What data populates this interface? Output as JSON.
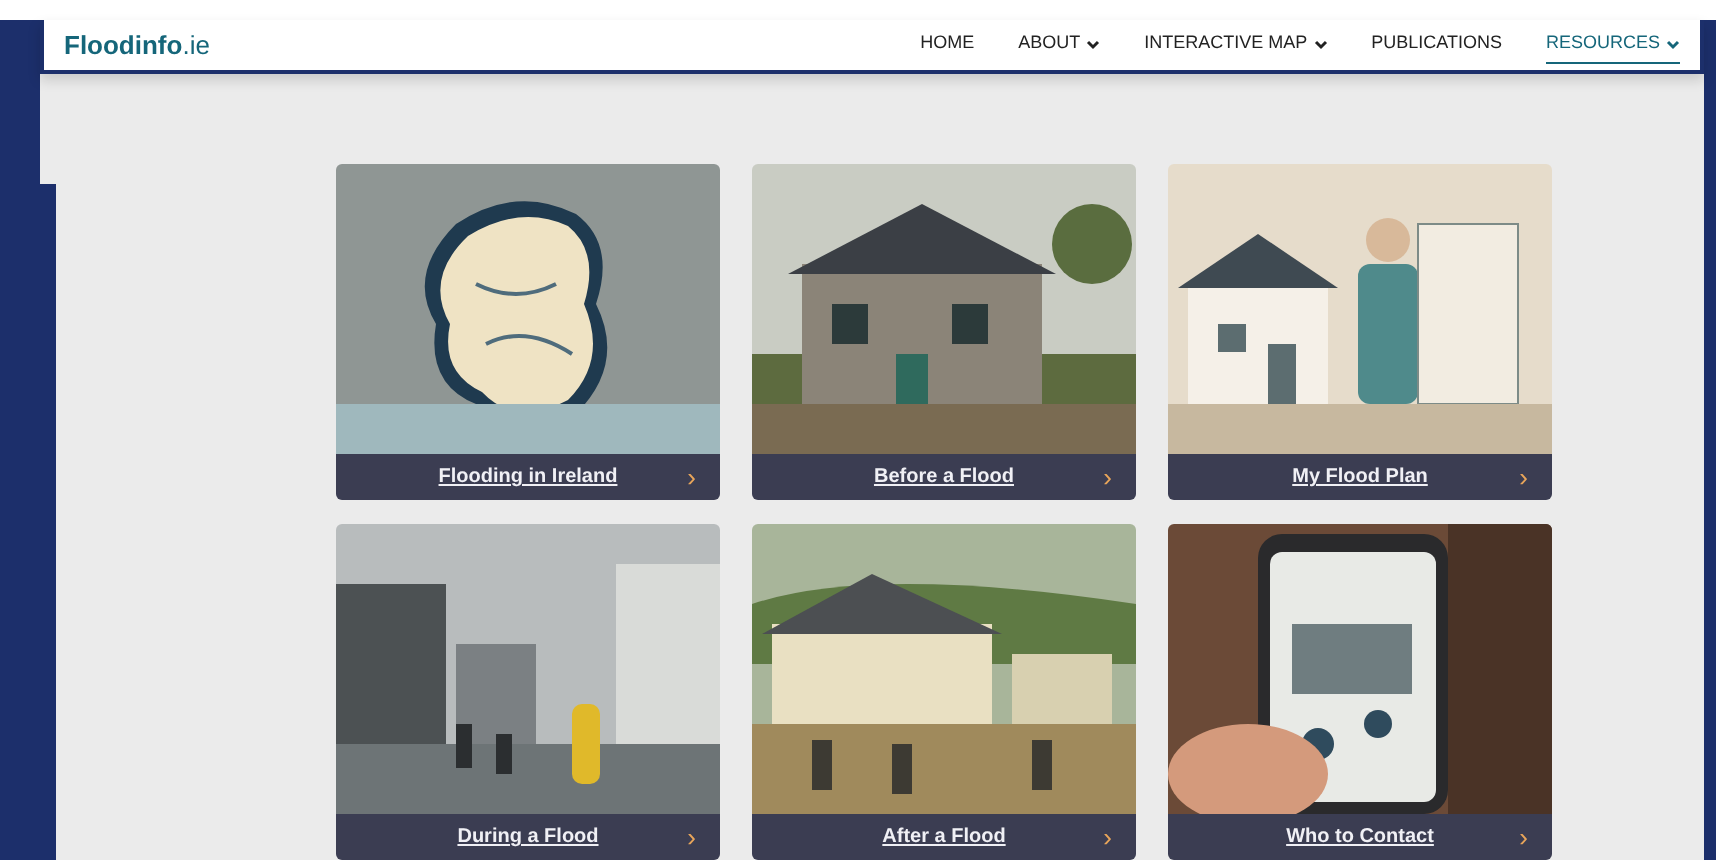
{
  "site": {
    "logo": "Floodinfo",
    "logo_suffix": ".ie"
  },
  "nav": [
    {
      "label": "HOME",
      "dropdown": false,
      "selected": false
    },
    {
      "label": "ABOUT",
      "dropdown": true,
      "selected": false
    },
    {
      "label": "INTERACTIVE MAP",
      "dropdown": true,
      "selected": false
    },
    {
      "label": "PUBLICATIONS",
      "dropdown": false,
      "selected": false
    },
    {
      "label": "RESOURCES",
      "dropdown": true,
      "selected": true
    }
  ],
  "cards": [
    {
      "title": "Flooding in Ireland",
      "arrow": "›",
      "kind": "picture"
    },
    {
      "title": "Before a Flood",
      "arrow": "›",
      "kind": "picture"
    },
    {
      "title": "My Flood Plan",
      "arrow": "›",
      "kind": "picture"
    },
    {
      "title": "During a Flood",
      "arrow": "›",
      "kind": "picture"
    },
    {
      "title": "After a Flood",
      "arrow": "›",
      "kind": "picture"
    },
    {
      "title": "Who to Contact",
      "arrow": "›",
      "kind": "picture"
    }
  ]
}
